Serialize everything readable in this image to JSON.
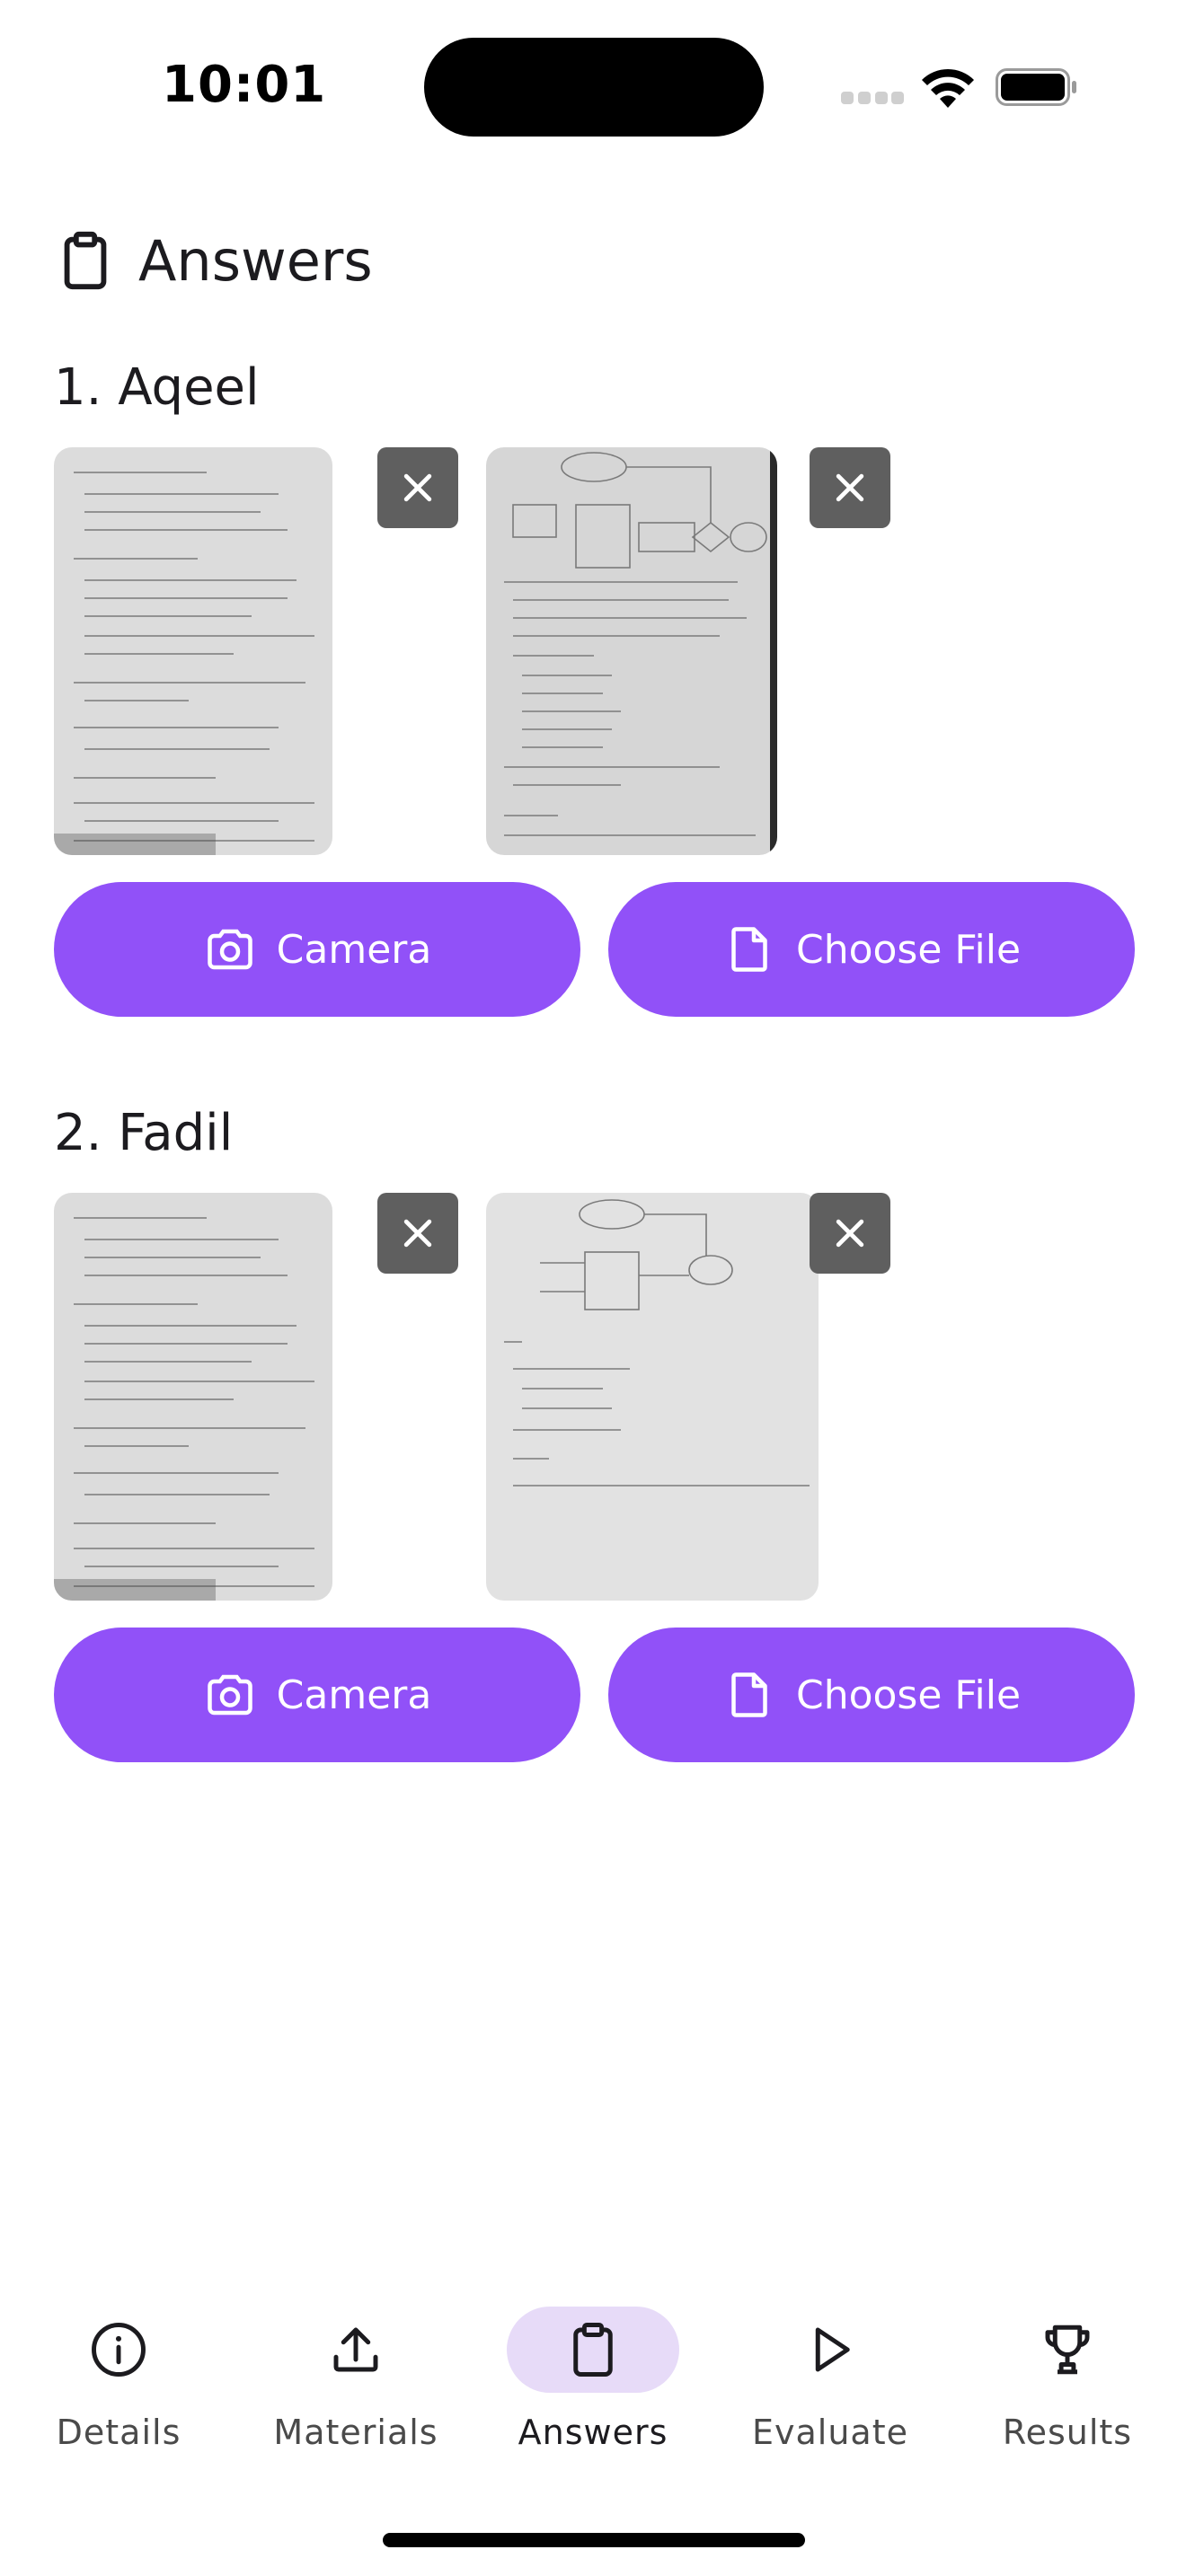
{
  "status_bar": {
    "time": "10:01"
  },
  "header": {
    "title": "Answers",
    "icon": "clipboard-icon"
  },
  "students": [
    {
      "heading": "1. Aqeel",
      "images": 2,
      "camera_label": "Camera",
      "file_label": "Choose File"
    },
    {
      "heading": "2. Fadil",
      "images": 2,
      "camera_label": "Camera",
      "file_label": "Choose File"
    }
  ],
  "bottom_nav": {
    "items": [
      {
        "label": "Details",
        "icon": "info-icon"
      },
      {
        "label": "Materials",
        "icon": "upload-icon"
      },
      {
        "label": "Answers",
        "icon": "clipboard-icon",
        "active": true
      },
      {
        "label": "Evaluate",
        "icon": "play-icon"
      },
      {
        "label": "Results",
        "icon": "trophy-icon"
      }
    ]
  },
  "colors": {
    "accent": "#9151f8",
    "nav_active_bg": "#e7dbf8",
    "remove_bg": "#5f5f5f"
  }
}
